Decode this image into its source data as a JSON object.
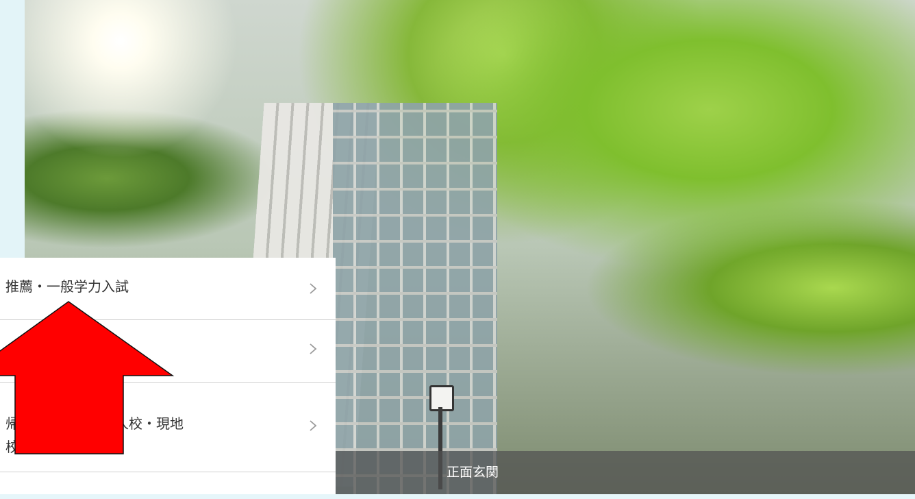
{
  "menu": {
    "items": [
      {
        "label": "推薦・一般学力入試"
      },
      {
        "label": ""
      },
      {
        "label_line1": "帰　　　　　日本人校・現地",
        "label_line2": "校"
      },
      {
        "label": "　　　　　　　　　　"
      }
    ]
  },
  "photo": {
    "caption": "正面玄関"
  },
  "annotation": {
    "arrow_color": "#ff0000"
  },
  "icons": {
    "chevron": "chevron-right-icon",
    "arrow": "up-arrow-annotation"
  }
}
